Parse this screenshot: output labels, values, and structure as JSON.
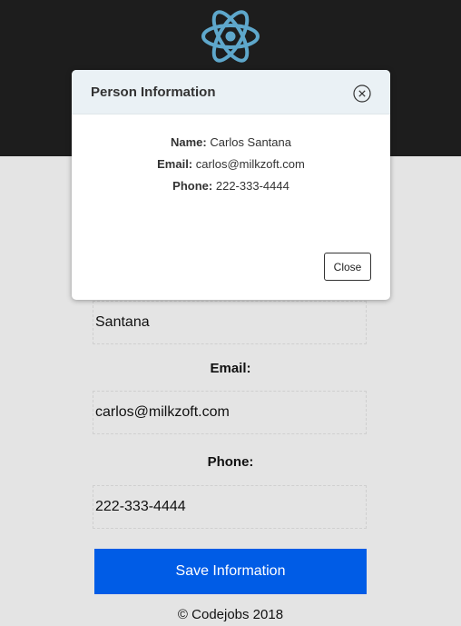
{
  "header": {
    "logo_icon": "react-atom-icon",
    "background": "#1d1d1d",
    "logo_color": "#5ea7cb"
  },
  "form": {
    "last_name_value": "Santana",
    "email_label": "Email:",
    "email_value": "carlos@milkzoft.com",
    "phone_label": "Phone:",
    "phone_value": "222-333-4444",
    "save_button_label": "Save Information",
    "save_button_color": "#005ce6"
  },
  "footer": {
    "text": "© Codejobs 2018"
  },
  "modal": {
    "title": "Person Information",
    "close_icon": "circle-x-icon",
    "name_key": "Name:",
    "name_value": "Carlos Santana",
    "email_key": "Email:",
    "email_value": "carlos@milkzoft.com",
    "phone_key": "Phone:",
    "phone_value": "222-333-4444",
    "close_button_label": "Close",
    "header_color": "#eaf1f5"
  }
}
